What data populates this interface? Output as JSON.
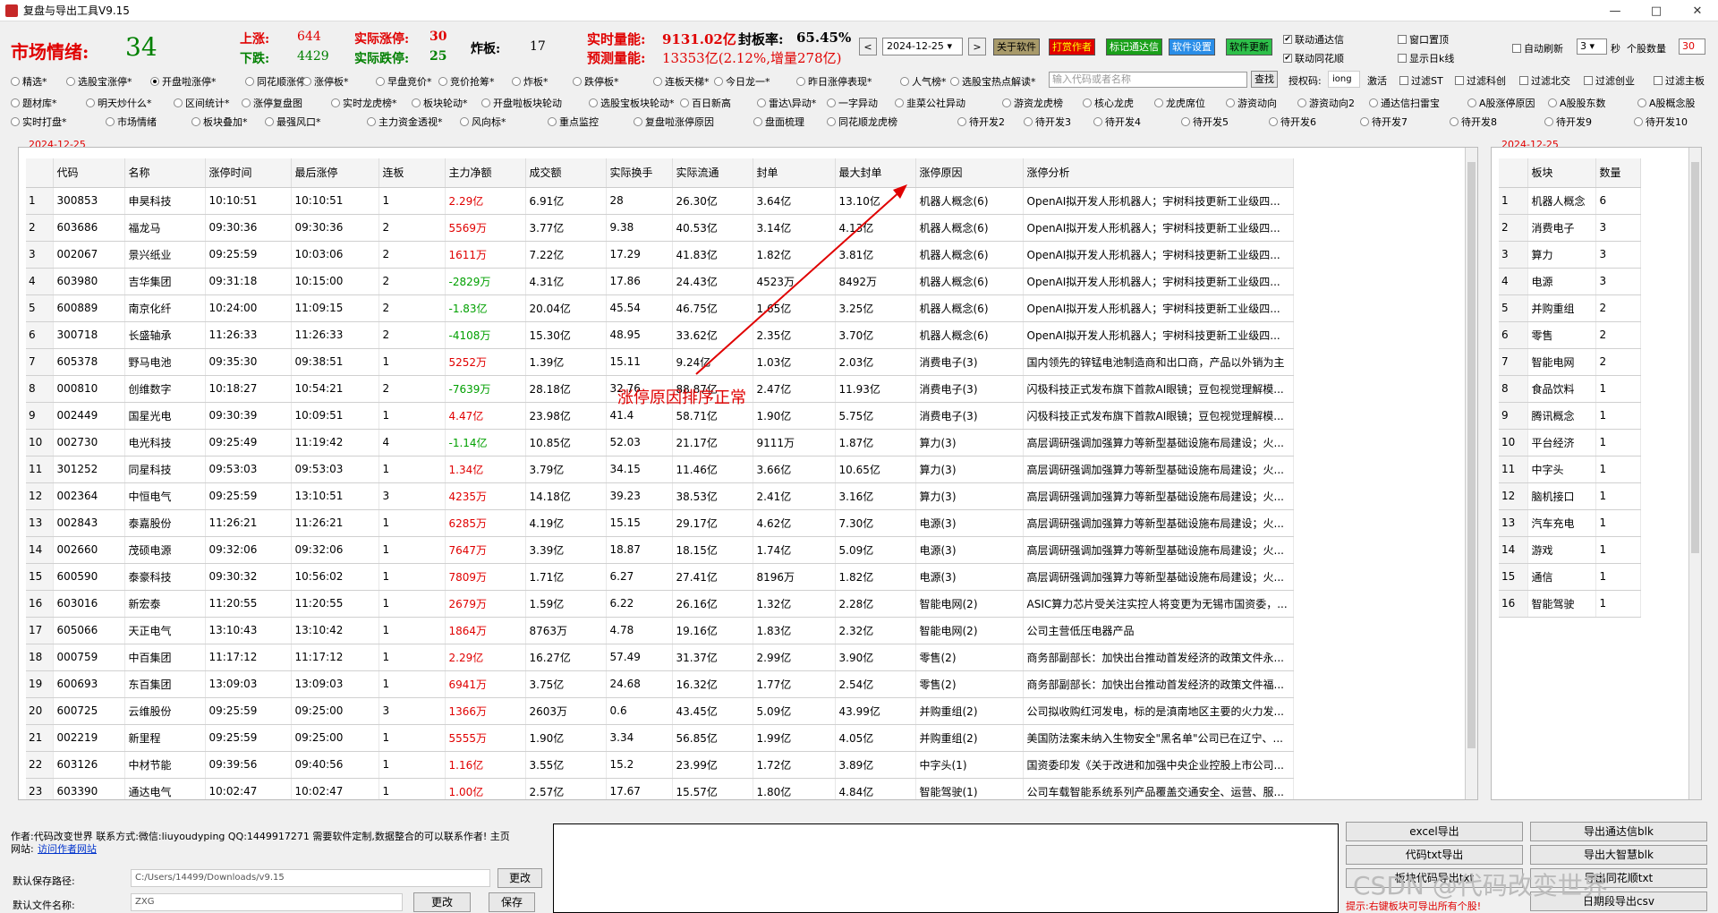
{
  "app": {
    "title": "复盘与导出工具V9.15",
    "win_min": "—",
    "win_max": "□",
    "win_close": "✕"
  },
  "header": {
    "mood_label": "市场情绪:",
    "mood_value": "34",
    "up_label": "上涨:",
    "up_value": "644",
    "down_label": "下跌:",
    "down_value": "4429",
    "zt_label": "实际涨停:",
    "zt_value": "30",
    "dt_label": "实际跌停:",
    "dt_value": "25",
    "zb_label": "炸板:",
    "zb_value": "17",
    "vol_label": "实时量能:",
    "vol_value": "9131.02亿",
    "fbl_label": "封板率:",
    "fbl_value": "65.45%",
    "pred_label": "预测量能:",
    "pred_value": "13353亿(2.12%,增量278亿)"
  },
  "toolbar": {
    "prev": "<",
    "date": "2024-12-25",
    "next": ">",
    "about": "关于软件",
    "author": "打赏作者",
    "tdx": "标记通达信",
    "settings": "软件设置",
    "update": "软件更新",
    "link_tdx": "联动通达信",
    "link_ths": "联动同花顺",
    "pin": "窗口置顶",
    "show_k": "显示日k线",
    "auto_refresh": "自动刷新",
    "refresh_val": "3",
    "sec": "秒",
    "count_label": "个股数量",
    "count_val": "30"
  },
  "radios_row1": [
    "精选*",
    "选股宝涨停*",
    "开盘啦涨停*",
    "同花顺涨停*",
    "涨停板*",
    "早盘竞价*",
    "竞价抢筹*",
    "炸板*",
    "跌停板*",
    "连板天梯*",
    "今日龙一*",
    "昨日涨停表现*",
    "人气榜*",
    "选股宝热点解读*"
  ],
  "search": {
    "placeholder": "输入代码或者名称",
    "btn": "查找",
    "auth_label": "授权码:",
    "auth_val": "iong",
    "activate": "激活",
    "f1": "过滤ST",
    "f2": "过滤科创",
    "f3": "过滤北交",
    "f4": "过滤创业",
    "f5": "过滤主板"
  },
  "radios_row2": [
    "题材库*",
    "明天炒什么*",
    "区间统计*",
    "涨停复盘图",
    "实时龙虎榜*",
    "板块轮动*",
    "开盘啦板块轮动",
    "选股宝板块轮动*",
    "百日新高",
    "雷达\\异动*",
    "一字异动",
    "韭菜公社异动",
    "游资龙虎榜",
    "核心龙虎",
    "龙虎席位",
    "游资动向",
    "游资动向2",
    "通达信扫雷宝",
    "A股涨停原因",
    "A股股东数",
    "A股概念股"
  ],
  "radios_row3": [
    "实时打盘*",
    "市场情绪",
    "板块叠加*",
    "最强风口*",
    "主力资金透视*",
    "风向标*",
    "重点监控",
    "复盘啦涨停原因",
    "盘面梳理",
    "同花顺龙虎榜",
    "待开发2",
    "待开发3",
    "待开发4",
    "待开发5",
    "待开发6",
    "待开发7",
    "待开发8",
    "待开发9",
    "待开发10"
  ],
  "main_table": {
    "date": "2024-12-25",
    "headers": [
      "",
      "代码",
      "名称",
      "涨停时间",
      "最后涨停",
      "连板",
      "主力净额",
      "成交额",
      "实际换手",
      "实际流通",
      "封单",
      "最大封单",
      "涨停原因",
      "涨停分析"
    ],
    "rows": [
      [
        "1",
        "300853",
        "申昊科技",
        "10:10:51",
        "10:10:51",
        "1",
        "2.29亿",
        "6.91亿",
        "28",
        "26.30亿",
        "3.64亿",
        "13.10亿",
        "机器人概念(6)",
        "OpenAI拟开发人形机器人；宇树科技更新工业级四..."
      ],
      [
        "2",
        "603686",
        "福龙马",
        "09:30:36",
        "09:30:36",
        "2",
        "5569万",
        "3.77亿",
        "9.38",
        "40.53亿",
        "3.14亿",
        "4.13亿",
        "机器人概念(6)",
        "OpenAI拟开发人形机器人；宇树科技更新工业级四..."
      ],
      [
        "3",
        "002067",
        "景兴纸业",
        "09:25:59",
        "10:03:06",
        "2",
        "1611万",
        "7.22亿",
        "17.29",
        "41.83亿",
        "1.82亿",
        "3.81亿",
        "机器人概念(6)",
        "OpenAI拟开发人形机器人；宇树科技更新工业级四..."
      ],
      [
        "4",
        "603980",
        "吉华集团",
        "09:31:18",
        "10:15:00",
        "2",
        "-2829万",
        "4.31亿",
        "17.86",
        "24.43亿",
        "4523万",
        "8492万",
        "机器人概念(6)",
        "OpenAI拟开发人形机器人；宇树科技更新工业级四..."
      ],
      [
        "5",
        "600889",
        "南京化纤",
        "10:24:00",
        "11:09:15",
        "2",
        "-1.83亿",
        "20.04亿",
        "45.54",
        "46.75亿",
        "1.65亿",
        "3.25亿",
        "机器人概念(6)",
        "OpenAI拟开发人形机器人；宇树科技更新工业级四..."
      ],
      [
        "6",
        "300718",
        "长盛轴承",
        "11:26:33",
        "11:26:33",
        "2",
        "-4108万",
        "15.30亿",
        "48.95",
        "33.62亿",
        "2.35亿",
        "3.70亿",
        "机器人概念(6)",
        "OpenAI拟开发人形机器人；宇树科技更新工业级四..."
      ],
      [
        "7",
        "605378",
        "野马电池",
        "09:35:30",
        "09:38:51",
        "1",
        "5252万",
        "1.39亿",
        "15.11",
        "9.24亿",
        "1.03亿",
        "2.03亿",
        "消费电子(3)",
        "国内领先的锌锰电池制造商和出口商，产品以外销为主"
      ],
      [
        "8",
        "000810",
        "创维数字",
        "10:18:27",
        "10:54:21",
        "2",
        "-7639万",
        "28.18亿",
        "32.76",
        "88.87亿",
        "2.47亿",
        "11.93亿",
        "消费电子(3)",
        "闪极科技正式发布旗下首款AI眼镜；豆包视觉理解模..."
      ],
      [
        "9",
        "002449",
        "国星光电",
        "09:30:39",
        "10:09:51",
        "1",
        "4.47亿",
        "23.98亿",
        "41.4",
        "58.71亿",
        "1.90亿",
        "5.75亿",
        "消费电子(3)",
        "闪极科技正式发布旗下首款AI眼镜；豆包视觉理解模..."
      ],
      [
        "10",
        "002730",
        "电光科技",
        "09:25:49",
        "11:19:42",
        "4",
        "-1.14亿",
        "10.85亿",
        "52.03",
        "21.17亿",
        "9111万",
        "1.87亿",
        "算力(3)",
        "高层调研强调加强算力等新型基础设施布局建设；火..."
      ],
      [
        "11",
        "301252",
        "同星科技",
        "09:53:03",
        "09:53:03",
        "1",
        "1.34亿",
        "3.79亿",
        "34.15",
        "11.46亿",
        "3.66亿",
        "10.65亿",
        "算力(3)",
        "高层调研强调加强算力等新型基础设施布局建设；火..."
      ],
      [
        "12",
        "002364",
        "中恒电气",
        "09:25:59",
        "13:10:51",
        "3",
        "4235万",
        "14.18亿",
        "39.23",
        "38.53亿",
        "2.41亿",
        "3.16亿",
        "算力(3)",
        "高层调研强调加强算力等新型基础设施布局建设；火..."
      ],
      [
        "13",
        "002843",
        "泰嘉股份",
        "11:26:21",
        "11:26:21",
        "1",
        "6285万",
        "4.19亿",
        "15.15",
        "29.17亿",
        "4.62亿",
        "7.30亿",
        "电源(3)",
        "高层调研强调加强算力等新型基础设施布局建设；火..."
      ],
      [
        "14",
        "002660",
        "茂硕电源",
        "09:32:06",
        "09:32:06",
        "1",
        "7647万",
        "3.39亿",
        "18.87",
        "18.15亿",
        "1.74亿",
        "5.09亿",
        "电源(3)",
        "高层调研强调加强算力等新型基础设施布局建设；火..."
      ],
      [
        "15",
        "600590",
        "泰豪科技",
        "09:30:32",
        "10:56:02",
        "1",
        "7809万",
        "1.71亿",
        "6.27",
        "27.41亿",
        "8196万",
        "1.82亿",
        "电源(3)",
        "高层调研强调加强算力等新型基础设施布局建设；火..."
      ],
      [
        "16",
        "603016",
        "新宏泰",
        "11:20:55",
        "11:20:55",
        "1",
        "2679万",
        "1.59亿",
        "6.22",
        "26.16亿",
        "1.32亿",
        "2.28亿",
        "智能电网(2)",
        "ASIC算力芯片受关注实控人将变更为无锡市国资委，..."
      ],
      [
        "17",
        "605066",
        "天正电气",
        "13:10:43",
        "13:10:42",
        "1",
        "1864万",
        "8763万",
        "4.78",
        "19.16亿",
        "1.83亿",
        "2.32亿",
        "智能电网(2)",
        "公司主营低压电器产品"
      ],
      [
        "18",
        "000759",
        "中百集团",
        "11:17:12",
        "11:17:12",
        "1",
        "2.29亿",
        "16.27亿",
        "57.49",
        "31.37亿",
        "2.99亿",
        "3.90亿",
        "零售(2)",
        "商务部副部长：加快出台推动首发经济的政策文件永..."
      ],
      [
        "19",
        "600693",
        "东百集团",
        "13:09:03",
        "13:09:03",
        "1",
        "6941万",
        "3.75亿",
        "24.68",
        "16.32亿",
        "1.77亿",
        "2.54亿",
        "零售(2)",
        "商务部副部长：加快出台推动首发经济的政策文件福..."
      ],
      [
        "20",
        "600725",
        "云维股份",
        "09:25:59",
        "09:25:00",
        "3",
        "1366万",
        "2603万",
        "0.6",
        "43.45亿",
        "5.09亿",
        "43.99亿",
        "并购重组(2)",
        "公司拟收购红河发电，标的是滇南地区主要的火力发..."
      ],
      [
        "21",
        "002219",
        "新里程",
        "09:25:59",
        "09:25:00",
        "1",
        "5555万",
        "1.90亿",
        "3.34",
        "56.85亿",
        "1.99亿",
        "4.05亿",
        "并购重组(2)",
        "美国防法案未纳入生物安全\"黑名单\"公司已在辽宁、..."
      ],
      [
        "22",
        "603126",
        "中材节能",
        "09:39:56",
        "09:40:56",
        "1",
        "1.16亿",
        "3.55亿",
        "15.2",
        "23.99亿",
        "1.72亿",
        "3.89亿",
        "中字头(1)",
        "国资委印发《关于改进和加强中央企业控股上市公司..."
      ],
      [
        "23",
        "603390",
        "通达电气",
        "10:02:47",
        "10:02:47",
        "1",
        "1.00亿",
        "2.57亿",
        "17.67",
        "15.57亿",
        "1.80亿",
        "4.84亿",
        "智能驾驶(1)",
        "公司车载智能系统系列产品覆盖交通安全、运营、服..."
      ]
    ]
  },
  "side_table": {
    "date": "2024-12-25",
    "headers": [
      "",
      "板块",
      "数量"
    ],
    "rows": [
      [
        "1",
        "机器人概念",
        "6"
      ],
      [
        "2",
        "消费电子",
        "3"
      ],
      [
        "3",
        "算力",
        "3"
      ],
      [
        "4",
        "电源",
        "3"
      ],
      [
        "5",
        "并购重组",
        "2"
      ],
      [
        "6",
        "零售",
        "2"
      ],
      [
        "7",
        "智能电网",
        "2"
      ],
      [
        "8",
        "食品饮料",
        "1"
      ],
      [
        "9",
        "腾讯概念",
        "1"
      ],
      [
        "10",
        "平台经济",
        "1"
      ],
      [
        "11",
        "中字头",
        "1"
      ],
      [
        "12",
        "脑机接口",
        "1"
      ],
      [
        "13",
        "汽车充电",
        "1"
      ],
      [
        "14",
        "游戏",
        "1"
      ],
      [
        "15",
        "通信",
        "1"
      ],
      [
        "16",
        "智能驾驶",
        "1"
      ]
    ]
  },
  "annotation": {
    "text": "涨停原因排序正常",
    "color": "#e00000"
  },
  "footer": {
    "author_line": "作者:代码改变世界  联系方式:微信:liuyoudyping QQ:1449917271 需要软件定制,数据整合的可以联系作者! 主页",
    "site_label": "网站:",
    "site_link": "访问作者网站",
    "save_path_label": "默认保存路径:",
    "save_path": "C:/Users/14499/Downloads/v9.15",
    "change1": "更改",
    "file_name_label": "默认文件名称:",
    "file_name": "ZXG",
    "change2": "更改",
    "save": "保存",
    "excel": "excel导出",
    "tdx_export": "导出通达信blk",
    "txt": "代码txt导出",
    "dzh": "导出大智慧blk",
    "stock_txt": "板块代码导出txt",
    "ths_txt": "导出同花顺txt",
    "segment_csv": "日期段导出csv",
    "tip": "提示:右键板块可导出所有个股!",
    "watermark": "CSDN @代码改变世界"
  }
}
